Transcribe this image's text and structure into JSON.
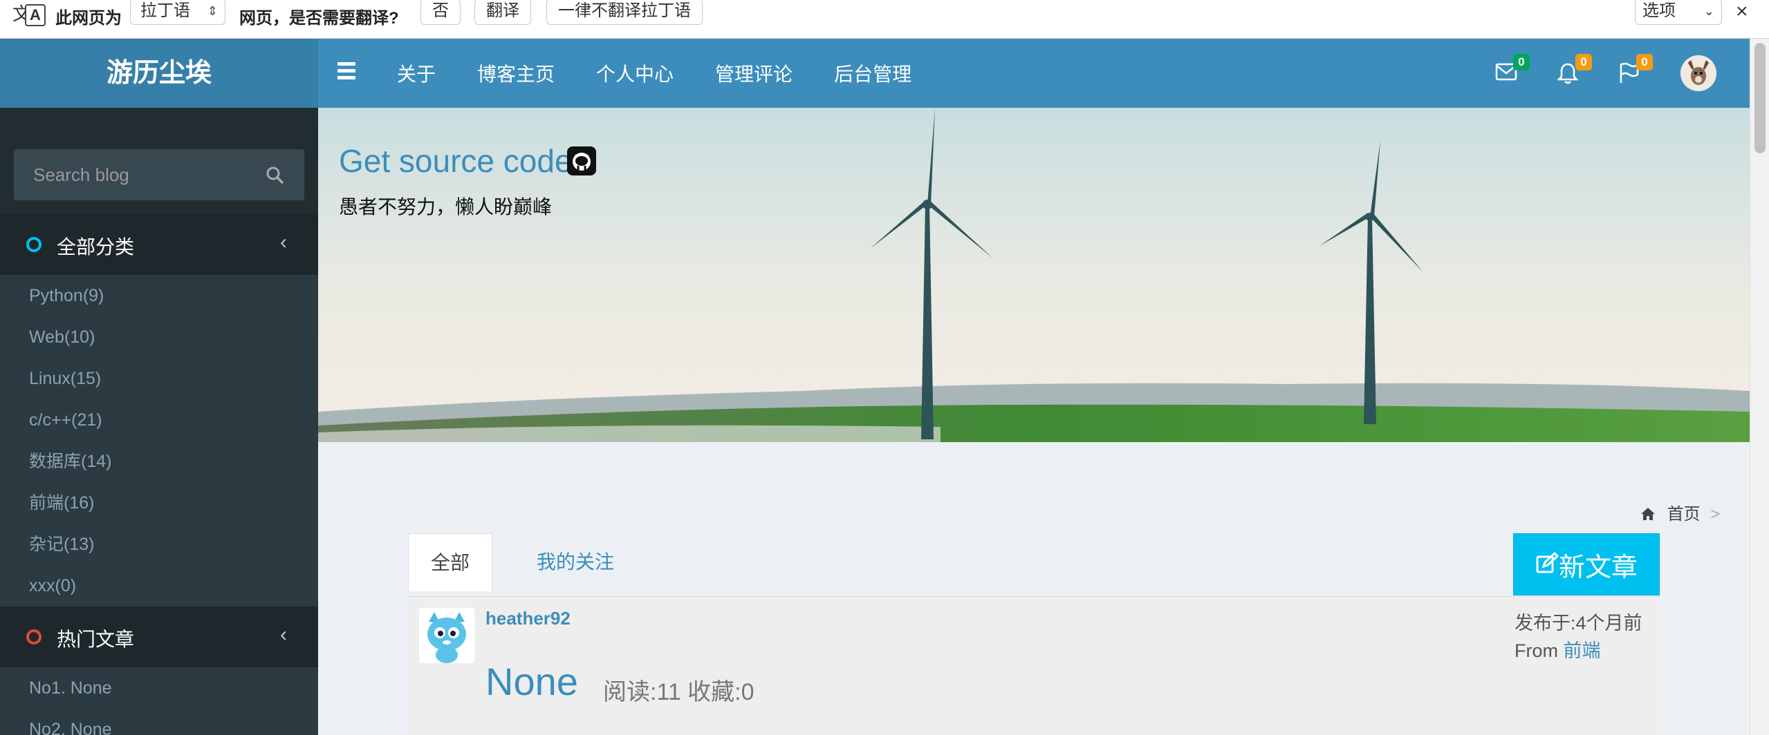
{
  "translate_bar": {
    "text_before": "此网页为",
    "language": "拉丁语",
    "text_after": "网页，是否需要翻译?",
    "no_btn": "否",
    "translate_btn": "翻译",
    "never_btn": "一律不翻译拉丁语",
    "options": "选项"
  },
  "header": {
    "brand": "游历尘埃",
    "nav": [
      "关于",
      "博客主页",
      "个人中心",
      "管理评论",
      "后台管理"
    ],
    "mail_count": "0",
    "bell_count": "0",
    "flag_count": "0"
  },
  "sidebar": {
    "search_placeholder": "Search blog",
    "categories_title": "全部分类",
    "categories": [
      "Python(9)",
      "Web(10)",
      "Linux(15)",
      "c/c++(21)",
      "数据库(14)",
      "前端(16)",
      "杂记(13)",
      "xxx(0)"
    ],
    "hot_title": "热门文章",
    "hot": [
      "No1. None",
      "No2. None"
    ]
  },
  "banner": {
    "title": "Get source code",
    "subtitle": "愚者不努力，懒人盼巅峰"
  },
  "main": {
    "breadcrumb_home": "首页",
    "breadcrumb_sep": ">",
    "tab_all": "全部",
    "tab_follow": "我的关注",
    "new_post": "新文章",
    "post": {
      "author": "heather92",
      "published": "发布于:4个月前",
      "from_label": "From",
      "category": "前端",
      "title": "None",
      "stats": "阅读:11 收藏:0"
    }
  },
  "colors": {
    "header": "#3c8dbc",
    "brand": "#367fa9",
    "sidebar": "#222d32",
    "accent": "#00c0ef"
  }
}
